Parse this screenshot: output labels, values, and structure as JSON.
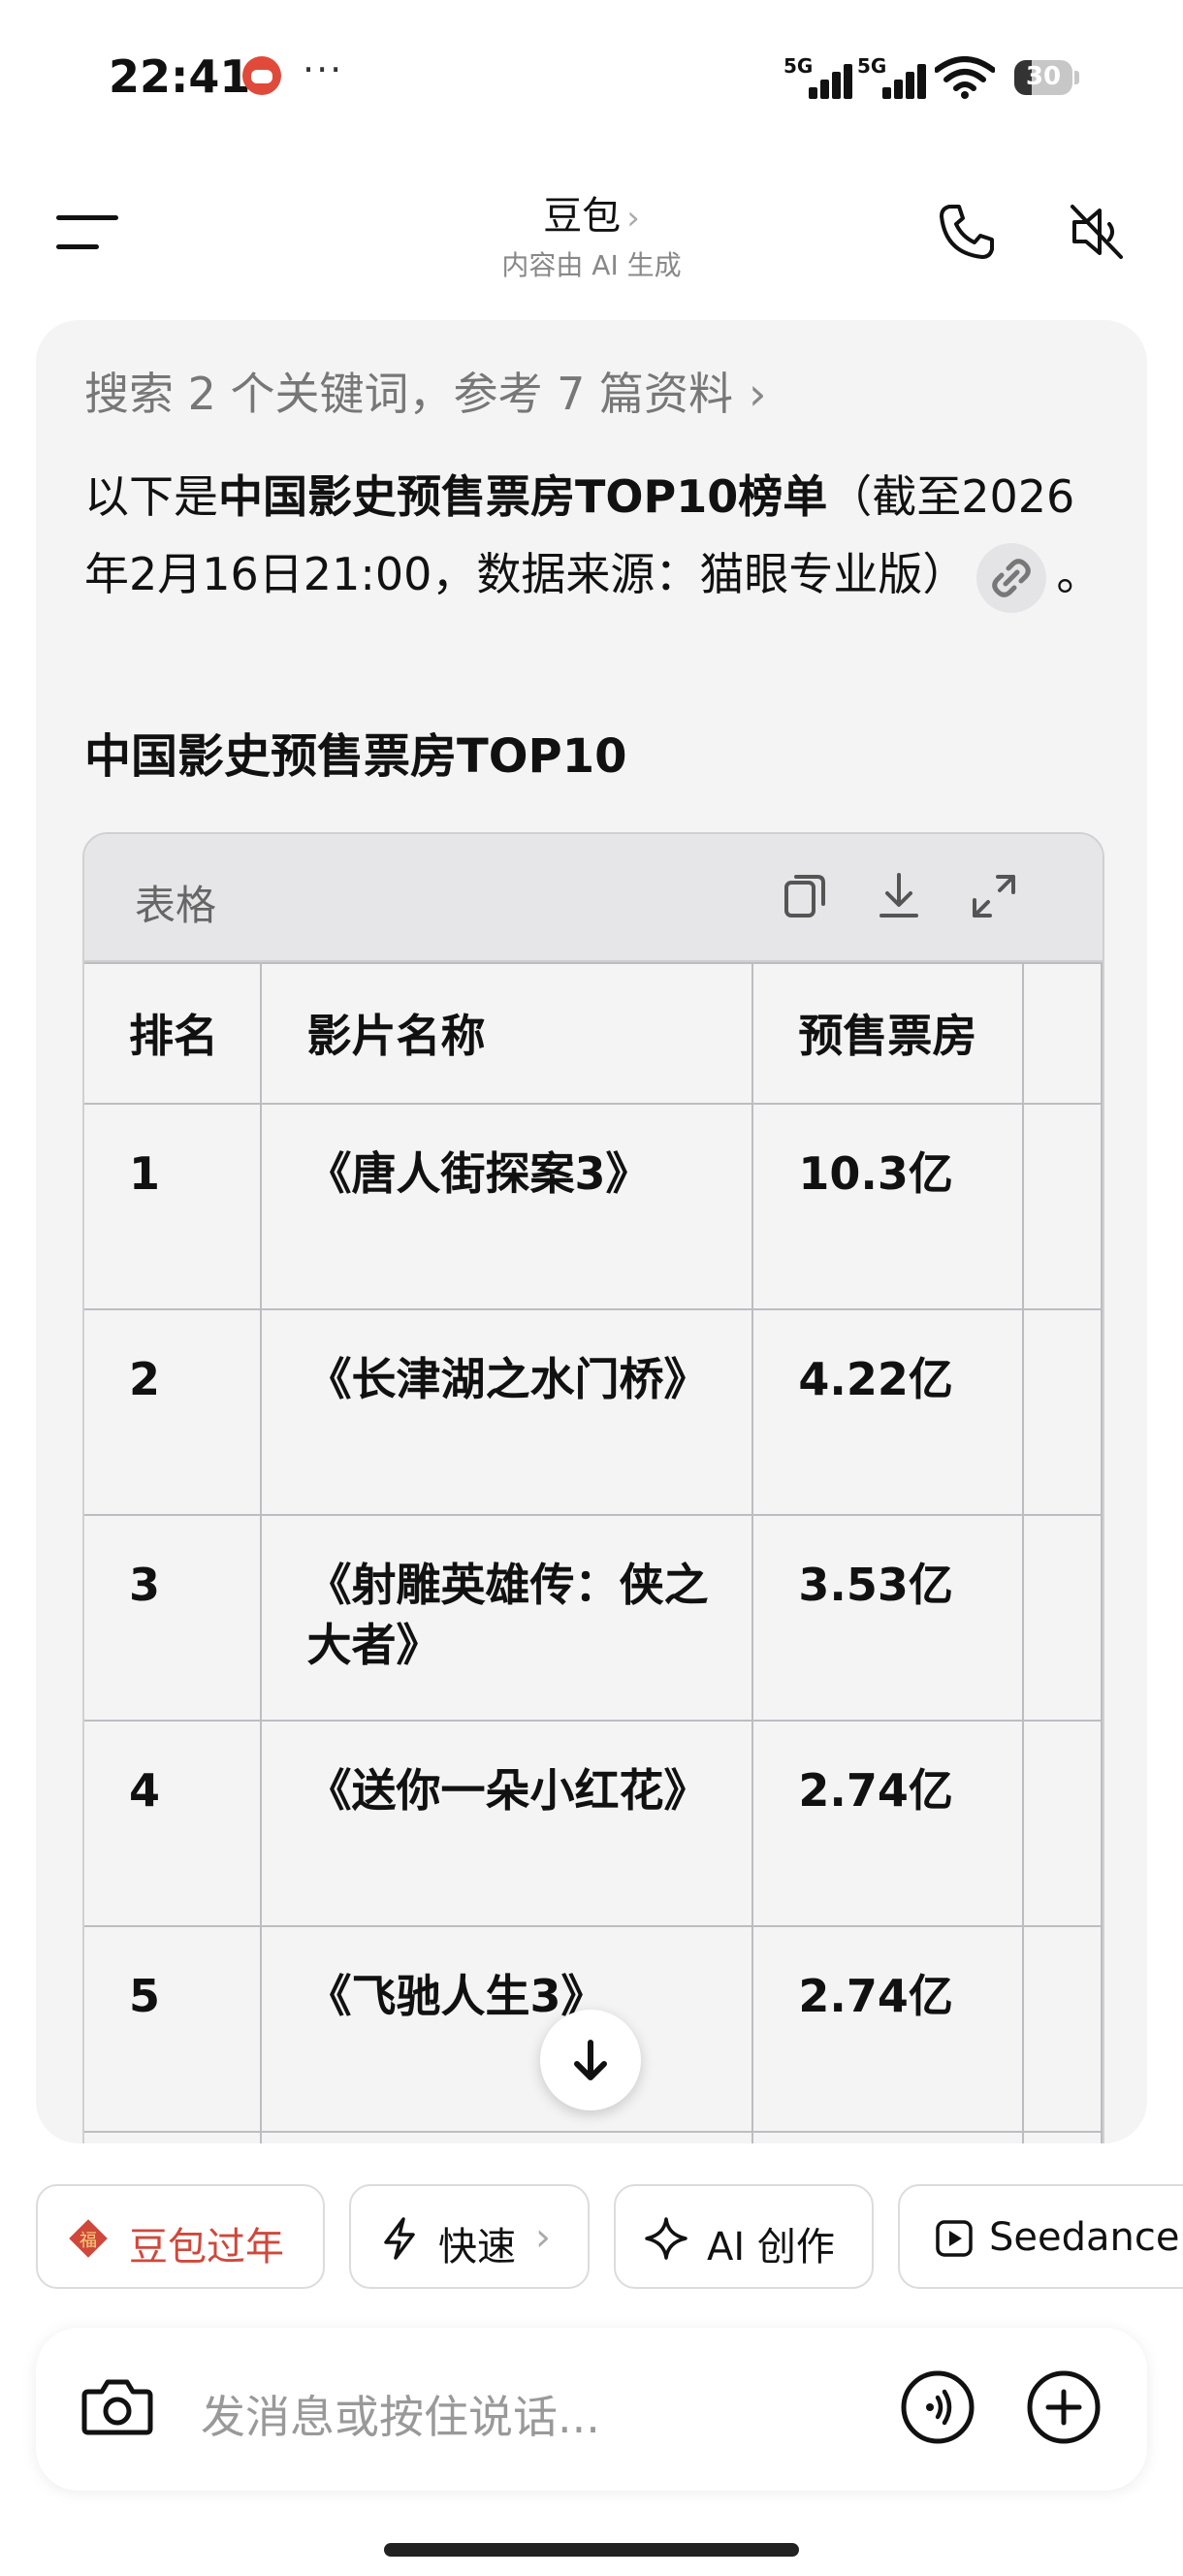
{
  "status_bar": {
    "time": "22:41",
    "dots": "···",
    "signal_1_label": "5G",
    "signal_2_label": "5G",
    "battery": "30"
  },
  "header": {
    "title": "豆包",
    "subtitle": "内容由 AI 生成"
  },
  "message": {
    "search_summary": "搜索 2 个关键词，参考 7 篇资料",
    "intro_prefix": "以下是",
    "intro_bold": "中国影史预售票房TOP10榜单",
    "intro_suffix": "（截至2026年2月16日21:00，数据来源：猫眼专业版）",
    "intro_end": "。",
    "section_title": "中国影史预售票房TOP10"
  },
  "table": {
    "label": "表格",
    "columns": [
      "排名",
      "影片名称",
      "预售票房"
    ],
    "rows": [
      [
        "1",
        "《唐人街探案3》",
        "10.3亿"
      ],
      [
        "2",
        "《长津湖之水门桥》",
        "4.22亿"
      ],
      [
        "3",
        "《射雕英雄传：侠之大者》",
        "3.53亿"
      ],
      [
        "4",
        "《送你一朵小红花》",
        "2.74亿"
      ],
      [
        "5",
        "《飞驰人生3》",
        "2.74亿"
      ]
    ]
  },
  "chips": {
    "new_year": "豆包过年",
    "fast": "快速",
    "ai_create": "AI 创作",
    "seedance": "Seedance"
  },
  "input": {
    "placeholder": "发消息或按住说话..."
  },
  "colors": {
    "accent_red": "#d0483b",
    "card_bg": "#f4f4f5"
  }
}
